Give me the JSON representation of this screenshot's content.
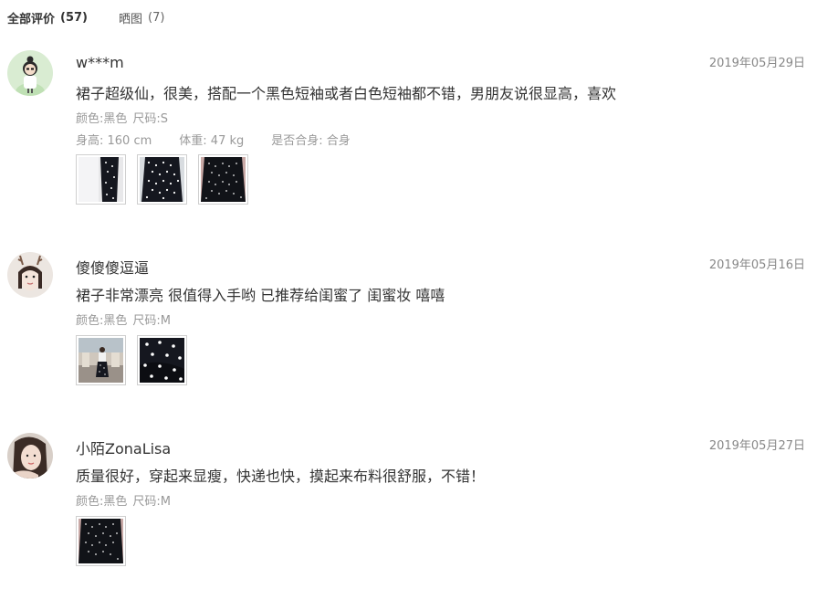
{
  "tabs": {
    "all_label": "全部评价",
    "all_count": "(57)",
    "photos_label": "晒图",
    "photos_count": "(7)"
  },
  "reviews": [
    {
      "user": "w***m",
      "date": "2019年05月29日",
      "text": "裙子超级仙，很美，搭配一个黑色短袖或者白色短袖都不错，男朋友说很显高，喜欢",
      "color": "颜色:黑色",
      "size": "尺码:S",
      "height": "身高: 160 cm",
      "weight": "体重: 47 kg",
      "fit": "是否合身: 合身",
      "photo_count": 3
    },
    {
      "user": "傻傻傻逗逼",
      "date": "2019年05月16日",
      "text": "裙子非常漂亮 很值得入手哟 已推荐给闺蜜了 闺蜜妆 嘻嘻",
      "color": "颜色:黑色",
      "size": "尺码:M",
      "photo_count": 2
    },
    {
      "user": "小陌ZonaLisa",
      "date": "2019年05月27日",
      "text": "质量很好，穿起来显瘦，快递也快，摸起来布料很舒服，不错！",
      "color": "颜色:黑色",
      "size": "尺码:M",
      "photo_count": 1
    }
  ],
  "colors": {
    "text_main": "#333333",
    "text_meta": "#999999",
    "date": "#888888",
    "thumb_border": "#cfcfcf",
    "polka_dark": "#15171f"
  }
}
